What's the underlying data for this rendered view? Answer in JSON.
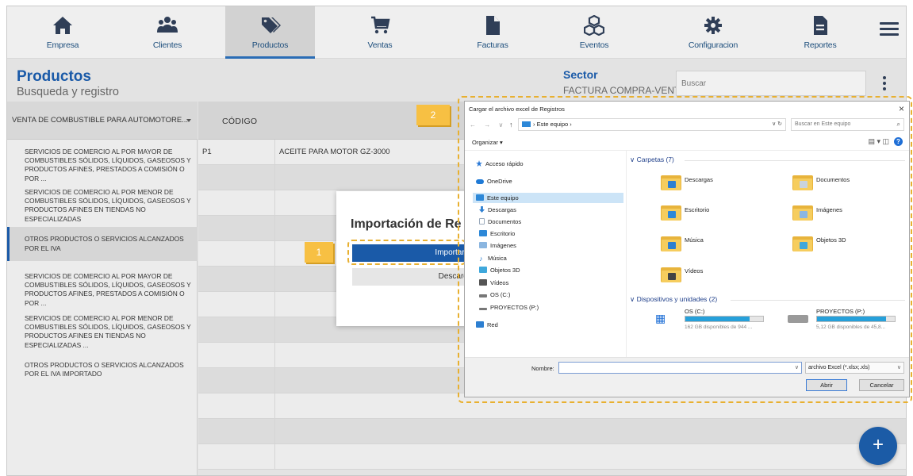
{
  "nav": {
    "items": [
      {
        "label": "Empresa",
        "icon": "home-icon"
      },
      {
        "label": "Clientes",
        "icon": "users-icon"
      },
      {
        "label": "Productos",
        "icon": "tags-icon"
      },
      {
        "label": "Ventas",
        "icon": "cart-icon"
      },
      {
        "label": "Facturas",
        "icon": "file-icon"
      },
      {
        "label": "Eventos",
        "icon": "cubes-icon"
      },
      {
        "label": "Configuracion",
        "icon": "gear-icon"
      },
      {
        "label": "Reportes",
        "icon": "report-icon"
      }
    ],
    "active": "Productos"
  },
  "header": {
    "title": "Productos",
    "subtitle": "Busqueda y registro",
    "sector_label": "Sector",
    "sector_value": "FACTURA COMPRA-VENTA",
    "search_placeholder": "Buscar"
  },
  "sidebar": {
    "selected_sector": "VENTA DE COMBUSTIBLE PARA AUTOMOTORE...",
    "items": [
      {
        "text": "SERVICIOS DE COMERCIO AL POR MAYOR DE COMBUSTIBLES SÓLIDOS, LÍQUIDOS, GASEOSOS Y PRODUCTOS AFINES, PRESTADOS A COMISIÓN O POR ..."
      },
      {
        "text": "SERVICIOS DE COMERCIO AL POR MENOR DE COMBUSTIBLES SÓLIDOS, LÍQUIDOS, GASEOSOS Y PRODUCTOS AFINES EN TIENDAS NO ESPECIALIZADAS"
      },
      {
        "text": "OTROS PRODUCTOS O SERVICIOS ALCANZADOS POR EL IVA"
      },
      {
        "text": "SERVICIOS DE COMERCIO AL POR MAYOR DE COMBUSTIBLES SÓLIDOS, LÍQUIDOS, GASEOSOS Y PRODUCTOS AFINES, PRESTADOS A COMISIÓN O POR ..."
      },
      {
        "text": "SERVICIOS DE COMERCIO AL POR MENOR DE COMBUSTIBLES SÓLIDOS, LÍQUIDOS, GASEOSOS Y PRODUCTOS AFINES EN TIENDAS NO ESPECIALIZADAS ..."
      },
      {
        "text": "OTROS PRODUCTOS O SERVICIOS ALCANZADOS POR EL IVA IMPORTADO"
      }
    ]
  },
  "table": {
    "header_code": "CÓDIGO",
    "rows": [
      {
        "code": "P1",
        "name": "ACEITE PARA MOTOR GZ-3000"
      }
    ]
  },
  "import_modal": {
    "title": "Importación de Re",
    "import_button": "Importar de",
    "download_button": "Descarga"
  },
  "steps": {
    "one": "1",
    "two": "2"
  },
  "file_dialog": {
    "title": "Cargar el archivo excel de Registros",
    "close": "×",
    "nav_arrows": "← → ∨",
    "up_arrow": "↑",
    "address": "› Este equipo ›",
    "address_controls": "∨ ↻",
    "search_placeholder": "Buscar en Este equipo",
    "organize": "Organizar ▾",
    "view_controls": "▤ ▾  ◫",
    "help": "?",
    "tree": [
      {
        "label": "Acceso rápido",
        "color": "#2b79d6"
      },
      {
        "label": "OneDrive",
        "color": "#1f7ad6"
      },
      {
        "label": "Este equipo",
        "color": "#2d88d8",
        "selected": true
      },
      {
        "label": "Descargas",
        "color": "#2d7fd1"
      },
      {
        "label": "Documentos",
        "color": "#9aa9bb"
      },
      {
        "label": "Escritorio",
        "color": "#2d88d8"
      },
      {
        "label": "Imágenes",
        "color": "#8bb6e0"
      },
      {
        "label": "Música",
        "color": "#2d7fd1"
      },
      {
        "label": "Objetos 3D",
        "color": "#3fa8dc"
      },
      {
        "label": "Vídeos",
        "color": "#555555"
      },
      {
        "label": "OS (C:)",
        "color": "#777777"
      },
      {
        "label": "PROYECTOS (P:)",
        "color": "#777777"
      },
      {
        "label": "Red",
        "color": "#2d7fd1"
      }
    ],
    "folders_group": "Carpetas (7)",
    "folders": [
      {
        "label": "Descargas",
        "emblem": "#2d7fd1"
      },
      {
        "label": "Documentos",
        "emblem": "#c9d3df"
      },
      {
        "label": "Escritorio",
        "emblem": "#2d88d8"
      },
      {
        "label": "Imágenes",
        "emblem": "#8bb6e0"
      },
      {
        "label": "Música",
        "emblem": "#2d7fd1"
      },
      {
        "label": "Objetos 3D",
        "emblem": "#3fa8dc"
      },
      {
        "label": "Vídeos",
        "emblem": "#444444"
      }
    ],
    "drives_group": "Dispositivos y unidades (2)",
    "drives": [
      {
        "label": "OS (C:)",
        "free": "162 GB disponibles de 944 ...",
        "used_fraction": 0.83
      },
      {
        "label": "PROYECTOS (P:)",
        "free": "5,12 GB disponibles de 45,8...",
        "used_fraction": 0.89
      }
    ],
    "name_label": "Nombre:",
    "name_value": "",
    "file_type": "archivo Excel (*.xlsx;.xls)",
    "open_button": "Abrir",
    "cancel_button": "Cancelar"
  },
  "fab_label": "+",
  "colors": {
    "accent": "#1a5aa8",
    "step_badge": "#f7c043"
  }
}
